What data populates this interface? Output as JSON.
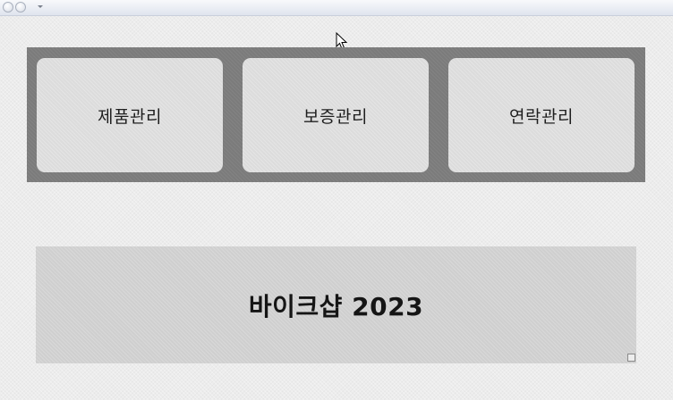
{
  "browser": {
    "back_icon": "back-arrow-icon",
    "forward_icon": "forward-arrow-icon",
    "history_icon": "chevron-down-icon"
  },
  "menu": {
    "items": [
      {
        "label": "제품관리"
      },
      {
        "label": "보증관리"
      },
      {
        "label": "연락관리"
      }
    ]
  },
  "banner": {
    "title": "바이크샵 2023"
  },
  "colors": {
    "page_background": "#ececec",
    "panel_background": "#7b7b7b",
    "button_background": "#dcdcdc",
    "banner_background": "#cfcfcf"
  }
}
